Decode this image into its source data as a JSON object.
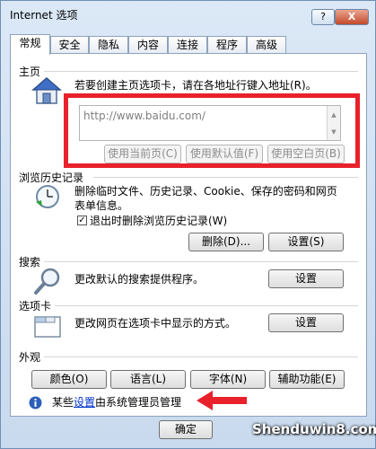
{
  "window": {
    "title": "Internet 选项",
    "help_label": "?",
    "close_label": "X"
  },
  "tabs": [
    {
      "label": "常规"
    },
    {
      "label": "安全"
    },
    {
      "label": "隐私"
    },
    {
      "label": "内容"
    },
    {
      "label": "连接"
    },
    {
      "label": "程序"
    },
    {
      "label": "高级"
    }
  ],
  "homepage": {
    "section_label": "主页",
    "description": "若要创建主页选项卡，请在各地址行键入地址(R)。",
    "url_value": "http://www.baidu.com/",
    "use_current_label": "使用当前页(C)",
    "use_default_label": "使用默认值(F)",
    "use_blank_label": "使用空白页(B)"
  },
  "history": {
    "section_label": "浏览历史记录",
    "description_line1": "删除临时文件、历史记录、Cookie、保存的密码和网页",
    "description_line2": "表单信息。",
    "checkbox_label": "退出时删除浏览历史记录(W)",
    "checkbox_checked": true,
    "delete_label": "删除(D)...",
    "settings_label": "设置(S)"
  },
  "search": {
    "section_label": "搜索",
    "description": "更改默认的搜索提供程序。",
    "settings_label": "设置"
  },
  "tabs_section": {
    "section_label": "选项卡",
    "description": "更改网页在选项卡中显示的方式。",
    "settings_label": "设置"
  },
  "appearance": {
    "section_label": "外观",
    "colors_label": "颜色(O)",
    "languages_label": "语言(L)",
    "fonts_label": "字体(N)",
    "accessibility_label": "辅助功能(E)"
  },
  "admin_notice": {
    "prefix": "某些",
    "link": "设置",
    "suffix": "由系统管理员管理"
  },
  "footer": {
    "ok_label": "确定"
  },
  "watermark": "Shenduwin8.com",
  "colors": {
    "highlight_box": "#e8212b",
    "link": "#0033cc"
  }
}
